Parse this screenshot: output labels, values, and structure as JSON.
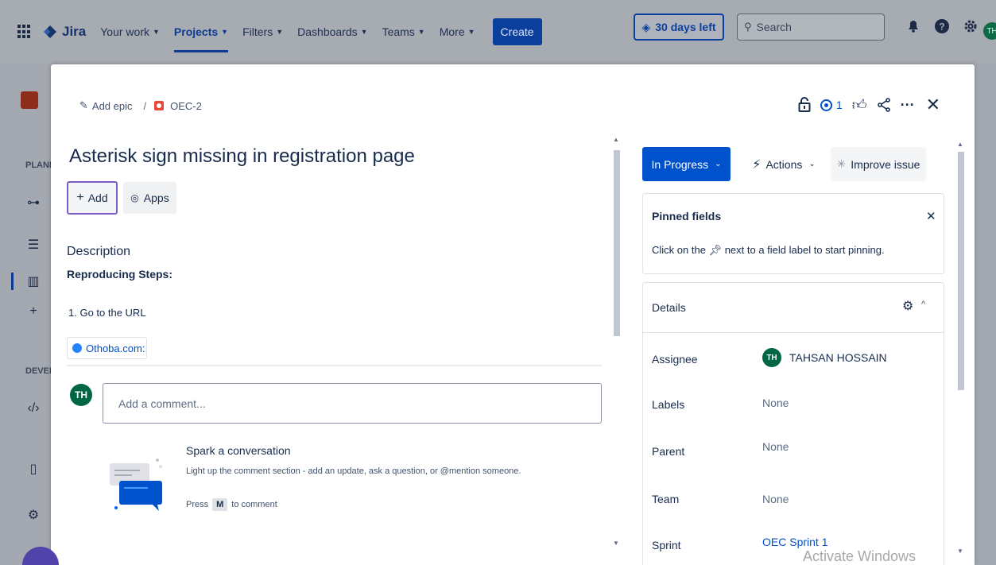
{
  "topnav": {
    "brand": "Jira",
    "items": [
      {
        "label": "Your work"
      },
      {
        "label": "Projects"
      },
      {
        "label": "Filters"
      },
      {
        "label": "Dashboards"
      },
      {
        "label": "Teams"
      },
      {
        "label": "More"
      }
    ],
    "create_label": "Create",
    "trial_label": "30 days left",
    "search_placeholder": "Search",
    "avatar_initials": "TH"
  },
  "sidebar": {
    "section_plan": "PLANI",
    "section_dev": "DEVEL"
  },
  "modal": {
    "breadcrumb": {
      "add_epic": "Add epic",
      "separator": "/",
      "issue_key": "OEC-2"
    },
    "watch_count": "1",
    "title": "Asterisk sign missing in registration page",
    "add_label": "Add",
    "apps_label": "Apps",
    "description_heading": "Description",
    "steps_heading": "Reproducing Steps:",
    "step_1": "1. Go to the URL",
    "link_text": "Othoba.com:",
    "comment": {
      "avatar_initials": "TH",
      "placeholder": "Add a comment..."
    },
    "spark": {
      "title": "Spark a conversation",
      "text": "Light up the comment section - add an update, ask a question, or @mention someone.",
      "press_prefix": "Press",
      "key": "M",
      "press_suffix": "to comment"
    },
    "status_label": "In Progress",
    "actions_label": "Actions",
    "improve_label": "Improve issue",
    "pinned": {
      "title": "Pinned fields",
      "text_before": "Click on the",
      "text_after": "next to a field label to start pinning."
    },
    "details": {
      "title": "Details",
      "rows": [
        {
          "label": "Assignee",
          "value": "TAHSAN HOSSAIN",
          "initials": "TH"
        },
        {
          "label": "Labels",
          "value": "None"
        },
        {
          "label": "Parent",
          "value": "None"
        },
        {
          "label": "Team",
          "value": "None"
        },
        {
          "label": "Sprint",
          "value": "OEC Sprint 1"
        }
      ]
    }
  },
  "watermark": "Activate Windows",
  "colors": {
    "brand_blue": "#0052cc",
    "assignee_green": "#006644",
    "bug_red": "#e5493a"
  }
}
